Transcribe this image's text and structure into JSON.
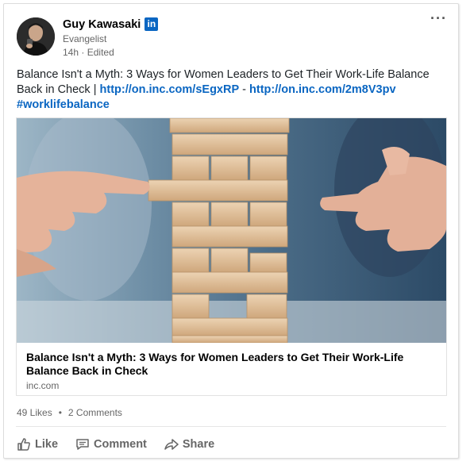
{
  "post": {
    "author": {
      "name": "Guy Kawasaki",
      "headline": "Evangelist",
      "badge": "in"
    },
    "meta": {
      "time": "14h",
      "separator": "·",
      "edited": "Edited"
    },
    "more_label": "···",
    "text": {
      "lead": "Balance Isn't a Myth: 3 Ways for Women Leaders to Get Their Work-Life Balance Back in Check | ",
      "link1": "http://on.inc.com/sEgxRP",
      "sep": " - ",
      "link2": "http://on.inc.com/2m8V3pv",
      "hashtag": "#worklifebalance"
    },
    "share": {
      "title": "Balance Isn't a Myth: 3 Ways for Women Leaders to Get Their Work-Life Balance Back in Check",
      "source": "inc.com"
    },
    "social": {
      "likes": "49 Likes",
      "dot": "•",
      "comments": "2 Comments"
    },
    "actions": {
      "like": "Like",
      "comment": "Comment",
      "share": "Share"
    }
  },
  "colors": {
    "link": "#0a66c2",
    "badge": "#0a66c2",
    "muted": "#666666"
  }
}
